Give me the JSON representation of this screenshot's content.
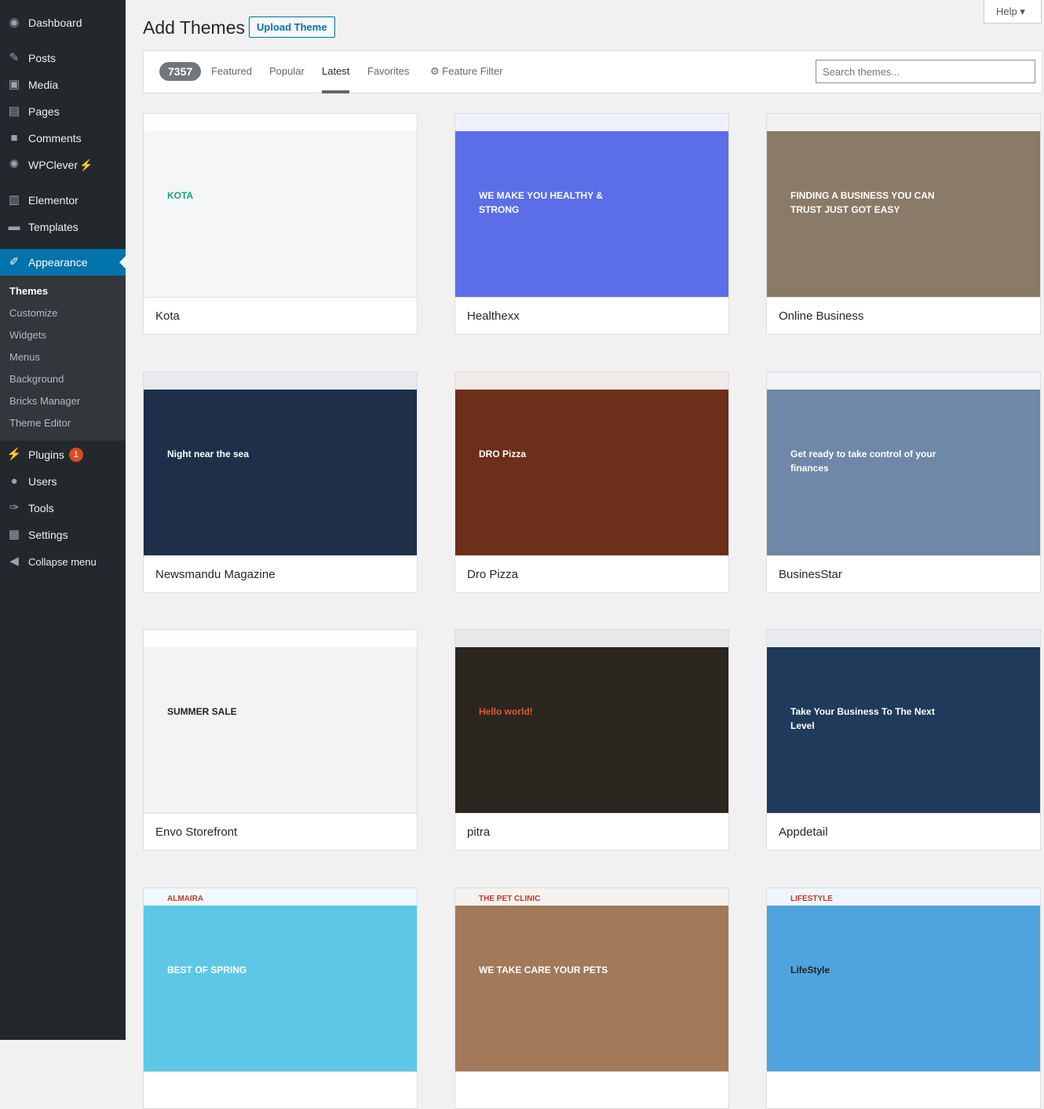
{
  "sidebar": {
    "items": [
      {
        "label": "Dashboard",
        "icon": "dashboard-icon"
      },
      {
        "label": "Posts",
        "icon": "pin-icon"
      },
      {
        "label": "Media",
        "icon": "media-icon"
      },
      {
        "label": "Pages",
        "icon": "pages-icon"
      },
      {
        "label": "Comments",
        "icon": "comments-icon"
      },
      {
        "label": "WPClever",
        "icon": "wpclever-icon"
      },
      {
        "label": "Elementor",
        "icon": "elementor-icon"
      },
      {
        "label": "Templates",
        "icon": "folder-icon"
      },
      {
        "label": "Appearance",
        "icon": "paintbrush-icon"
      },
      {
        "label": "Plugins",
        "icon": "plugin-icon",
        "badge": "1"
      },
      {
        "label": "Users",
        "icon": "users-icon"
      },
      {
        "label": "Tools",
        "icon": "wrench-icon"
      },
      {
        "label": "Settings",
        "icon": "settings-icon"
      },
      {
        "label": "Collapse menu",
        "icon": "collapse-icon"
      }
    ],
    "submenu": [
      "Themes",
      "Customize",
      "Widgets",
      "Menus",
      "Background",
      "Bricks Manager",
      "Theme Editor"
    ]
  },
  "header": {
    "title": "Add Themes",
    "upload": "Upload Theme",
    "help": "Help"
  },
  "filter": {
    "count": "7357",
    "tabs": [
      "Featured",
      "Popular",
      "Latest",
      "Favorites"
    ],
    "active": "Latest",
    "feature_filter": "Feature Filter",
    "search_placeholder": "Search themes..."
  },
  "themes": [
    {
      "name": "Kota",
      "bg": "#f4f6f8",
      "fg": "#1aa37a",
      "text": "KOTA"
    },
    {
      "name": "Healthexx",
      "bg": "#5b6ee8",
      "fg": "#ffffff",
      "text": "WE MAKE YOU HEALTHY & STRONG"
    },
    {
      "name": "Online Business",
      "bg": "#8a7a68",
      "fg": "#ffffff",
      "text": "FINDING A BUSINESS YOU CAN TRUST JUST GOT EASY"
    },
    {
      "name": "Newsmandu Magazine",
      "bg": "#1e2f4a",
      "fg": "#ffffff",
      "text": "Night near the sea"
    },
    {
      "name": "Dro Pizza",
      "bg": "#6b2f1a",
      "fg": "#ffffff",
      "text": "DRO Pizza"
    },
    {
      "name": "BusinesStar",
      "bg": "#6f88a8",
      "fg": "#ffffff",
      "text": "Get ready to take control of your finances"
    },
    {
      "name": "Envo Storefront",
      "bg": "#f3f3f3",
      "fg": "#222222",
      "text": "SUMMER SALE"
    },
    {
      "name": "pitra",
      "bg": "#2b2620",
      "fg": "#e05a2b",
      "text": "Hello world!"
    },
    {
      "name": "Appdetail",
      "bg": "#1f3a5a",
      "fg": "#ffffff",
      "text": "Take Your Business To The Next Level"
    },
    {
      "name": "almaira",
      "bg": "#5cc8e6",
      "fg": "#ffffff",
      "text": "BEST OF SPRING"
    },
    {
      "name": "The Pet Clinic",
      "bg": "#a27a5a",
      "fg": "#ffffff",
      "text": "WE TAKE CARE YOUR PETS"
    },
    {
      "name": "LifeStyle",
      "bg": "#4fa3dc",
      "fg": "#222222",
      "text": "LifeStyle"
    }
  ]
}
